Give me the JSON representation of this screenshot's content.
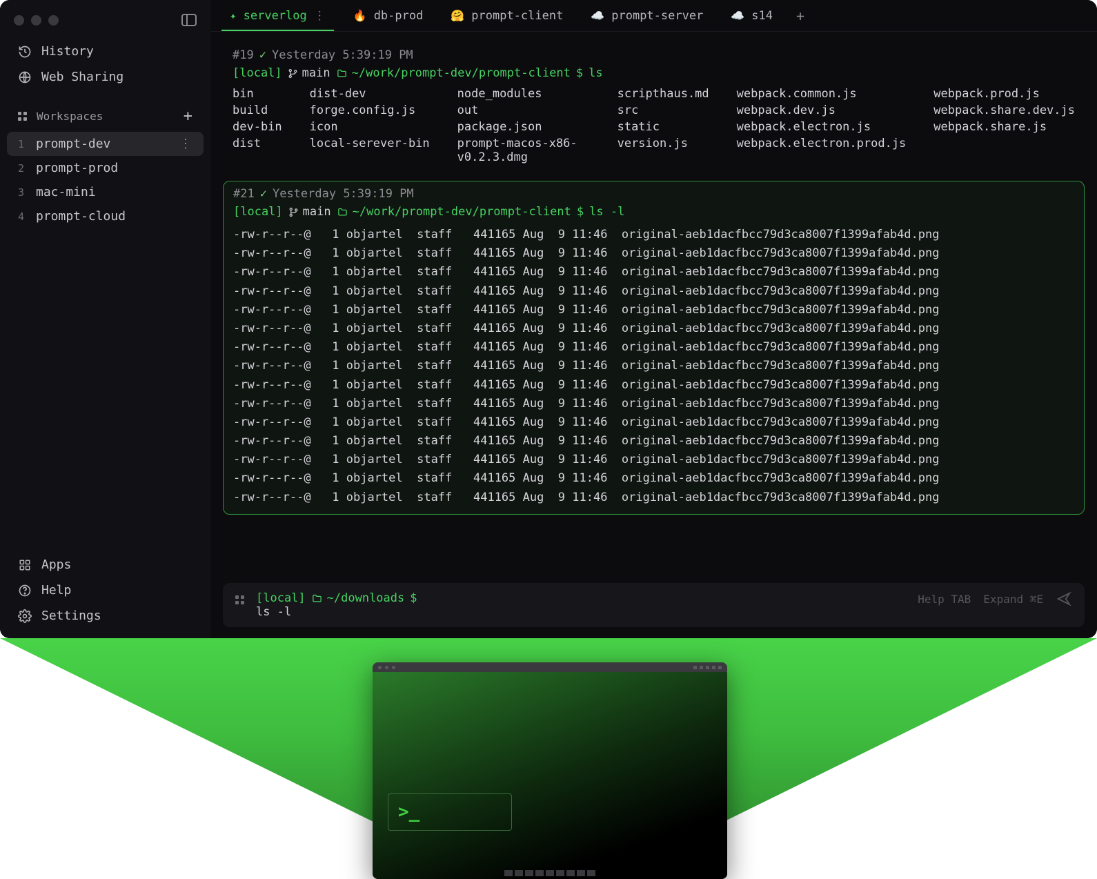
{
  "sidebar": {
    "history_label": "History",
    "websharing_label": "Web Sharing",
    "workspaces_label": "Workspaces",
    "workspaces": [
      {
        "num": "1",
        "label": "prompt-dev",
        "active": true
      },
      {
        "num": "2",
        "label": "prompt-prod"
      },
      {
        "num": "3",
        "label": "mac-mini"
      },
      {
        "num": "4",
        "label": "prompt-cloud"
      }
    ],
    "apps_label": "Apps",
    "help_label": "Help",
    "settings_label": "Settings"
  },
  "tabs": [
    {
      "icon": "✦",
      "label": "serverlog",
      "suffix": "⋮",
      "active": true,
      "icon_name": "sparkle-icon"
    },
    {
      "icon": "🔥",
      "label": "db-prod",
      "icon_name": "fire-icon"
    },
    {
      "icon": "🤗",
      "label": "prompt-client",
      "icon_name": "hug-icon"
    },
    {
      "icon": "☁️",
      "label": "prompt-server",
      "icon_name": "cloud-icon"
    },
    {
      "icon": "☁️",
      "label": "s14",
      "icon_name": "cloud-pink-icon"
    }
  ],
  "block1": {
    "meta_num": "#19",
    "meta_time": "Yesterday 5:39:19 PM",
    "local": "[local]",
    "branch": "main",
    "path": "~/work/prompt-dev/prompt-client",
    "dollar": "$",
    "cmd": "ls",
    "cols": [
      [
        "bin",
        "build",
        "dev-bin",
        "dist"
      ],
      [
        "dist-dev",
        "forge.config.js",
        "icon",
        "local-serever-bin"
      ],
      [
        "node_modules",
        "out",
        "package.json",
        "prompt-macos-x86-v0.2.3.dmg"
      ],
      [
        "scripthaus.md",
        "src",
        "static",
        "version.js"
      ],
      [
        "webpack.common.js",
        "webpack.dev.js",
        "webpack.electron.js",
        "webpack.electron.prod.js"
      ],
      [
        "webpack.prod.js",
        "webpack.share.dev.js",
        "webpack.share.js",
        ""
      ]
    ]
  },
  "block2": {
    "meta_num": "#21",
    "meta_time": "Yesterday 5:39:19 PM",
    "local": "[local]",
    "branch": "main",
    "path": "~/work/prompt-dev/prompt-client",
    "dollar": "$",
    "cmd": "ls -l",
    "row": "-rw-r--r--@   1 objartel  staff   441165 Aug  9 11:46  original-aeb1dacfbcc79d3ca8007f1399afab4d.png",
    "row_count": 15
  },
  "cmdbar": {
    "local": "[local]",
    "path": "~/downloads",
    "dollar": "$",
    "typed": "ls -l",
    "hint_help": "Help TAB",
    "hint_expand": "Expand ⌘E"
  },
  "mini": {
    "prompt": ">_"
  }
}
